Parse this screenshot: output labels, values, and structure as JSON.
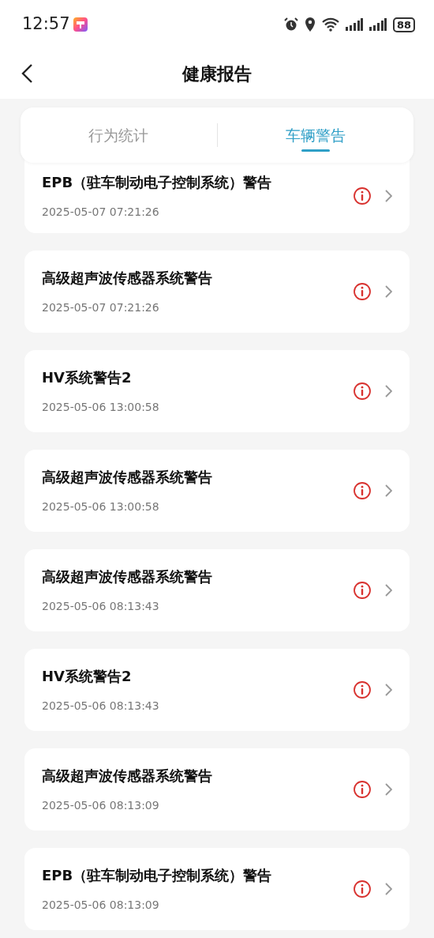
{
  "status_bar": {
    "time": "12:57",
    "battery": "88"
  },
  "header": {
    "title": "健康报告"
  },
  "tabs": [
    {
      "label": "行为统计",
      "selected": false
    },
    {
      "label": "车辆警告",
      "selected": true
    }
  ],
  "warnings": [
    {
      "title": "EPB（驻车制动电子控制系统）警告",
      "time": "2025-05-07 07:21:26"
    },
    {
      "title": "高级超声波传感器系统警告",
      "time": "2025-05-07 07:21:26"
    },
    {
      "title": "HV系统警告2",
      "time": "2025-05-06 13:00:58"
    },
    {
      "title": "高级超声波传感器系统警告",
      "time": "2025-05-06 13:00:58"
    },
    {
      "title": "高级超声波传感器系统警告",
      "time": "2025-05-06 08:13:43"
    },
    {
      "title": "HV系统警告2",
      "time": "2025-05-06 08:13:43"
    },
    {
      "title": "高级超声波传感器系统警告",
      "time": "2025-05-06 08:13:09"
    },
    {
      "title": "EPB（驻车制动电子控制系统）警告",
      "time": "2025-05-06 08:13:09"
    }
  ]
}
